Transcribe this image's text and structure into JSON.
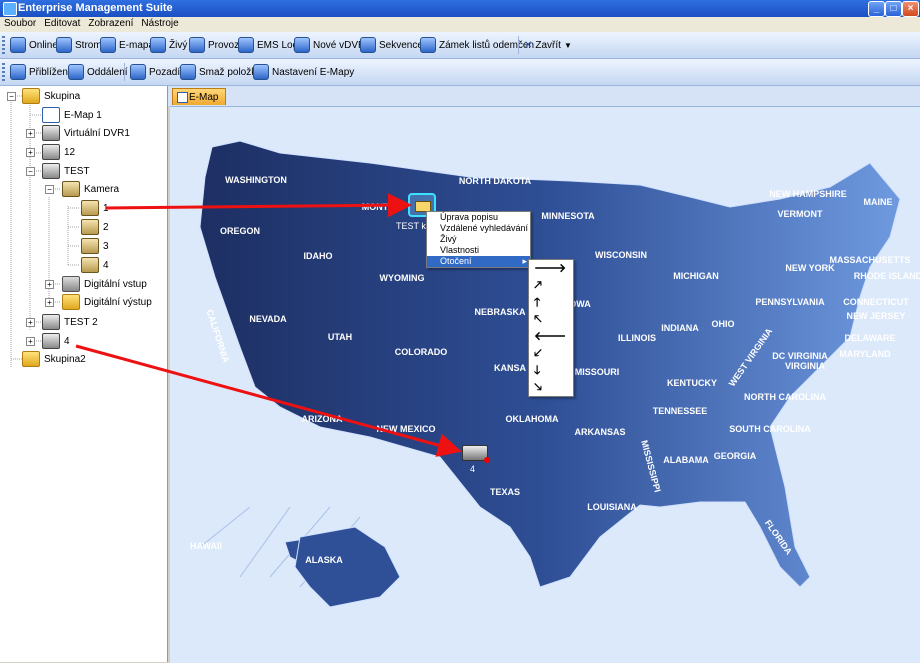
{
  "window": {
    "title": "Enterprise Management Suite"
  },
  "menu": [
    "Soubor",
    "Editovat",
    "Zobrazení",
    "Nástroje"
  ],
  "toolbar1": [
    "Online",
    "Strom",
    "E-mapa",
    "Živý",
    "Provoz",
    "EMS Log",
    "Nové vDVR",
    "Sekvence",
    "Zámek listů odemčen",
    "Zavřít"
  ],
  "toolbar2": [
    "Přiblížení",
    "Oddálení",
    "Pozadí",
    "Smaž položku",
    "Nastavení E-Mapy"
  ],
  "tree": {
    "root1": "Skupina",
    "emap": "E-Map 1",
    "vdvr": "Virtuální DVR1",
    "n12": "12",
    "test": "TEST",
    "kamera": "Kamera",
    "cam1": "1",
    "cam2": "2",
    "cam3": "3",
    "cam4": "4",
    "din": "Digitální vstup",
    "dout": "Digitální výstup",
    "test2": "TEST 2",
    "n4": "4",
    "root2": "Skupina2"
  },
  "tab": "E-Map 1",
  "map": {
    "camera_label": "TEST k",
    "dvr_label": "4",
    "states": [
      {
        "name": "WASHINGTON"
      },
      {
        "name": "OREGON"
      },
      {
        "name": "CALIFORNIA"
      },
      {
        "name": "IDAHO"
      },
      {
        "name": "NEVADA"
      },
      {
        "name": "MONT"
      },
      {
        "name": "WYOMING"
      },
      {
        "name": "UTAH"
      },
      {
        "name": "ARIZONA"
      },
      {
        "name": "COLORADO"
      },
      {
        "name": "NEW MEXICO"
      },
      {
        "name": "NORTH DAKOTA"
      },
      {
        "name": "NEBRASKA"
      },
      {
        "name": "KANSA"
      },
      {
        "name": "OKLAHOMA"
      },
      {
        "name": "TEXAS"
      },
      {
        "name": "MINNESOTA"
      },
      {
        "name": "OWA"
      },
      {
        "name": "MISSOURI"
      },
      {
        "name": "ARKANSAS"
      },
      {
        "name": "LOUISIANA"
      },
      {
        "name": "WISCONSIN"
      },
      {
        "name": "ILLINOIS"
      },
      {
        "name": "MICHIGAN"
      },
      {
        "name": "INDIANA"
      },
      {
        "name": "OHIO"
      },
      {
        "name": "KENTUCKY"
      },
      {
        "name": "TENNESSEE"
      },
      {
        "name": "MISSISSIPPI"
      },
      {
        "name": "ALABAMA"
      },
      {
        "name": "GEORGIA"
      },
      {
        "name": "FLORIDA"
      },
      {
        "name": "SOUTH CAROLINA"
      },
      {
        "name": "NORTH CAROLINA"
      },
      {
        "name": "VIRGINIA"
      },
      {
        "name": "WEST VIRGINIA"
      },
      {
        "name": "PENNSYLVANIA"
      },
      {
        "name": "NEW YORK"
      },
      {
        "name": "VERMONT"
      },
      {
        "name": "NEW HAMPSHIRE"
      },
      {
        "name": "MAINE"
      },
      {
        "name": "MASSACHUSETTS"
      },
      {
        "name": "RHODE ISLAND"
      },
      {
        "name": "CONNECTICUT"
      },
      {
        "name": "NEW JERSEY"
      },
      {
        "name": "DELAWARE"
      },
      {
        "name": "MARYLAND"
      },
      {
        "name": "DC VIRGINIA"
      },
      {
        "name": "HAWAII"
      },
      {
        "name": "ALASKA"
      }
    ]
  },
  "context_menu": [
    "Úprava popisu",
    "Vzdálené vyhledávání",
    "Živý",
    "Vlastnosti",
    "Otočení"
  ],
  "rotation_menu": [
    "🡒",
    "🡕",
    "🡑",
    "🡔",
    "🡐",
    "🡗",
    "🡓",
    "🡖"
  ],
  "colors": {
    "arrow": "#ee1111",
    "map_bg": "#dce9fa",
    "state_dark": "#1d3266",
    "state_light": "#5a86d4"
  }
}
